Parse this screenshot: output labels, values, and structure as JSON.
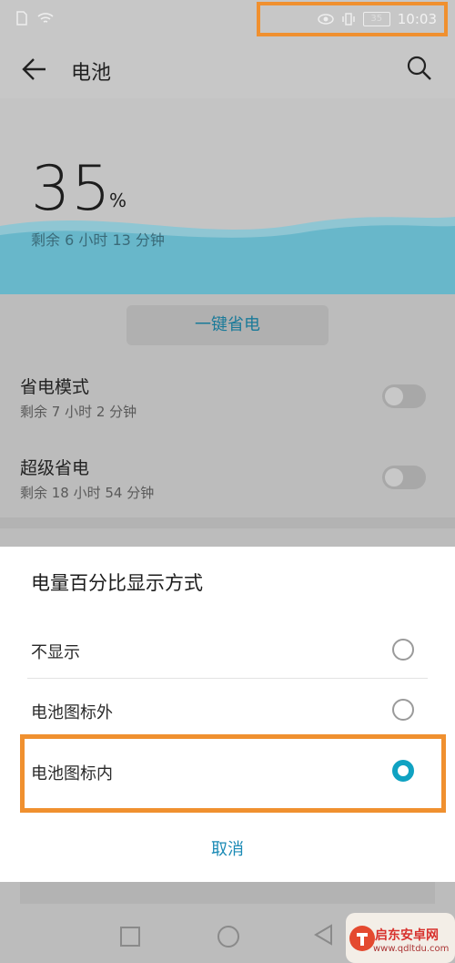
{
  "status_bar": {
    "battery_icon_text": "35",
    "time": "10:03"
  },
  "header": {
    "title": "电池"
  },
  "battery": {
    "percent": "35",
    "percent_sign": "%",
    "remaining": "剩余 6 小时 13 分钟"
  },
  "one_key_save": "一键省电",
  "settings": [
    {
      "title": "省电模式",
      "subtitle": "剩余 7 小时 2 分钟",
      "enabled": false
    },
    {
      "title": "超级省电",
      "subtitle": "剩余 18 小时 54 分钟",
      "enabled": false
    }
  ],
  "dialog": {
    "title": "电量百分比显示方式",
    "options": [
      {
        "label": "不显示",
        "selected": false
      },
      {
        "label": "电池图标外",
        "selected": false
      },
      {
        "label": "电池图标内",
        "selected": true
      }
    ],
    "cancel": "取消"
  },
  "colors": {
    "accent": "#10a2c2",
    "highlight_border": "#f0902f",
    "wave": "#5bb8cf"
  },
  "watermark": {
    "brand": "启东安卓网",
    "url": "www.qdltdu.com"
  }
}
